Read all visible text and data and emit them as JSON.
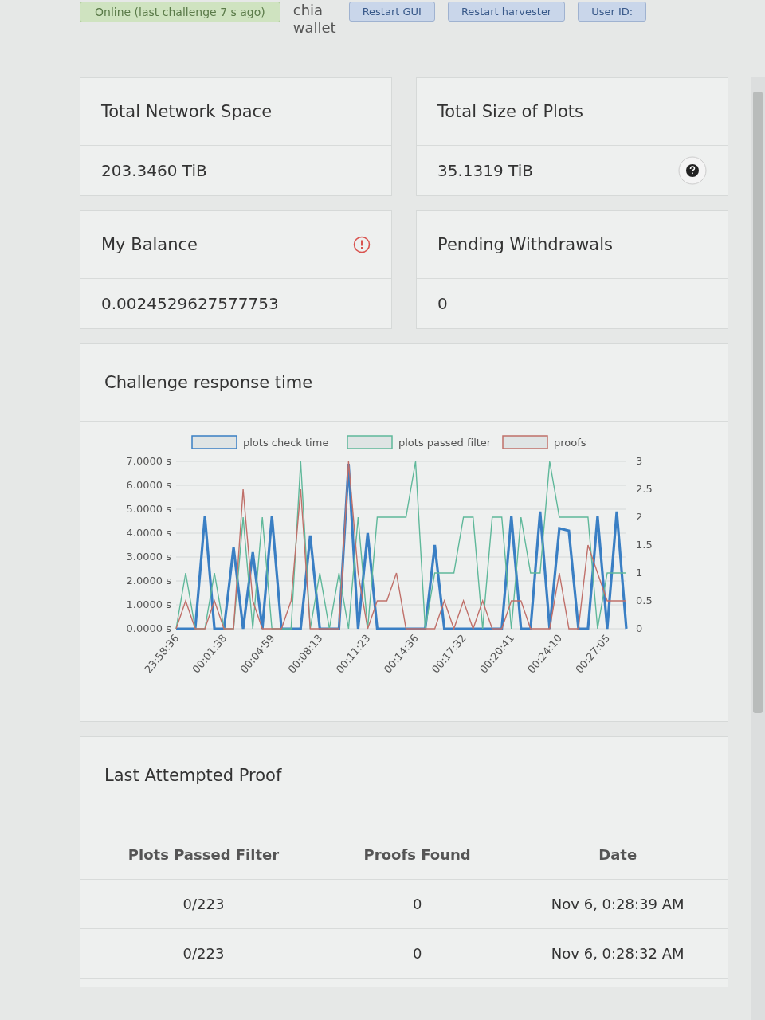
{
  "top_bar": {
    "status": "Online (last challenge 7 s ago)",
    "app_name": [
      "chia",
      "wallet"
    ],
    "buttons": [
      {
        "label": "Restart GUI"
      },
      {
        "label": "Restart harvester"
      },
      {
        "label": "User ID:"
      }
    ]
  },
  "cards": [
    {
      "title": "Total Network Space",
      "value": "203.3460 TiB"
    },
    {
      "title": "Total Size of Plots",
      "value": "35.1319 TiB"
    },
    {
      "title": "My Balance",
      "value": "0.0024529627577753"
    },
    {
      "title": "Pending Withdrawals",
      "value": "0"
    }
  ],
  "challenge_panel": {
    "title": "Challenge response time",
    "chart_data": {
      "type": "line",
      "categories": [
        "23:58:36",
        null,
        null,
        null,
        null,
        "00:01:38",
        null,
        null,
        null,
        null,
        "00:04:59",
        null,
        null,
        null,
        null,
        "00:08:13",
        null,
        null,
        null,
        null,
        "00:11:23",
        null,
        null,
        null,
        null,
        "00:14:36",
        null,
        null,
        null,
        null,
        "00:17:32",
        null,
        null,
        null,
        null,
        "00:20:41",
        null,
        null,
        null,
        null,
        "00:24:10",
        null,
        null,
        null,
        null,
        "00:27:05",
        null,
        null
      ],
      "ylim": [
        0,
        7
      ],
      "yticks": [
        {
          "value": 0,
          "label": "0.0000 s"
        },
        {
          "value": 1,
          "label": "1.0000 s"
        },
        {
          "value": 2,
          "label": "2.0000 s"
        },
        {
          "value": 3,
          "label": "3.0000 s"
        },
        {
          "value": 4,
          "label": "4.0000 s"
        },
        {
          "value": 5,
          "label": "5.0000 s"
        },
        {
          "value": 6,
          "label": "6.0000 s"
        },
        {
          "value": 7,
          "label": "7.0000 s"
        }
      ],
      "grid": true,
      "legend": "top",
      "y2lim": [
        0,
        3
      ],
      "y2ticks": [
        {
          "value": 0,
          "label": "0"
        },
        {
          "value": 0.5,
          "label": "0.5"
        },
        {
          "value": 1,
          "label": "1"
        },
        {
          "value": 1.5,
          "label": "1.5"
        },
        {
          "value": 2,
          "label": "2"
        },
        {
          "value": 2.5,
          "label": "2.5"
        },
        {
          "value": 3,
          "label": "3"
        }
      ],
      "series": [
        {
          "name": "plots check time",
          "color": "#3a7fc4",
          "values": [
            0,
            0,
            0,
            4.7,
            0,
            0,
            3.4,
            0,
            3.2,
            0,
            4.7,
            0,
            0,
            0,
            3.9,
            0,
            0,
            0,
            6.9,
            0,
            4.0,
            0,
            0,
            0,
            0,
            0,
            0,
            3.5,
            0,
            0,
            0,
            0,
            0,
            0,
            0,
            4.7,
            0,
            0,
            4.9,
            0,
            4.2,
            4.1,
            0,
            0,
            4.7,
            0,
            4.9,
            0
          ]
        },
        {
          "name": "plots passed filter",
          "color": "#5fb89a",
          "axis": "y2",
          "values": [
            0,
            1,
            0,
            0,
            1,
            0,
            0,
            2,
            0,
            2,
            0,
            0,
            0,
            3,
            0,
            1,
            0,
            1,
            0,
            2,
            0,
            2,
            2,
            2,
            2,
            3,
            0,
            1,
            1,
            1,
            2,
            2,
            0,
            2,
            2,
            0,
            2,
            1,
            1,
            3,
            2,
            2,
            2,
            2,
            0,
            1,
            1,
            1
          ]
        },
        {
          "name": "proofs",
          "color": "#c0706a",
          "axis": "y2",
          "values": [
            0,
            0.5,
            0,
            0,
            0.5,
            0,
            0,
            2.5,
            0.5,
            0,
            0,
            0,
            0.5,
            2.5,
            0,
            0,
            0,
            0,
            3,
            1,
            0,
            0.5,
            0.5,
            1,
            0,
            0,
            0,
            0,
            0.5,
            0,
            0.5,
            0,
            0.5,
            0,
            0,
            0.5,
            0.5,
            0,
            0,
            0,
            1,
            0,
            0,
            1.5,
            1,
            0.5,
            0.5,
            0.5
          ]
        }
      ]
    }
  },
  "proof_panel": {
    "title": "Last Attempted Proof",
    "columns": [
      "Plots Passed Filter",
      "Proofs Found",
      "Date"
    ],
    "rows": [
      [
        "0/223",
        "0",
        "Nov 6, 0:28:39 AM"
      ],
      [
        "0/223",
        "0",
        "Nov 6, 0:28:32 AM"
      ]
    ]
  }
}
